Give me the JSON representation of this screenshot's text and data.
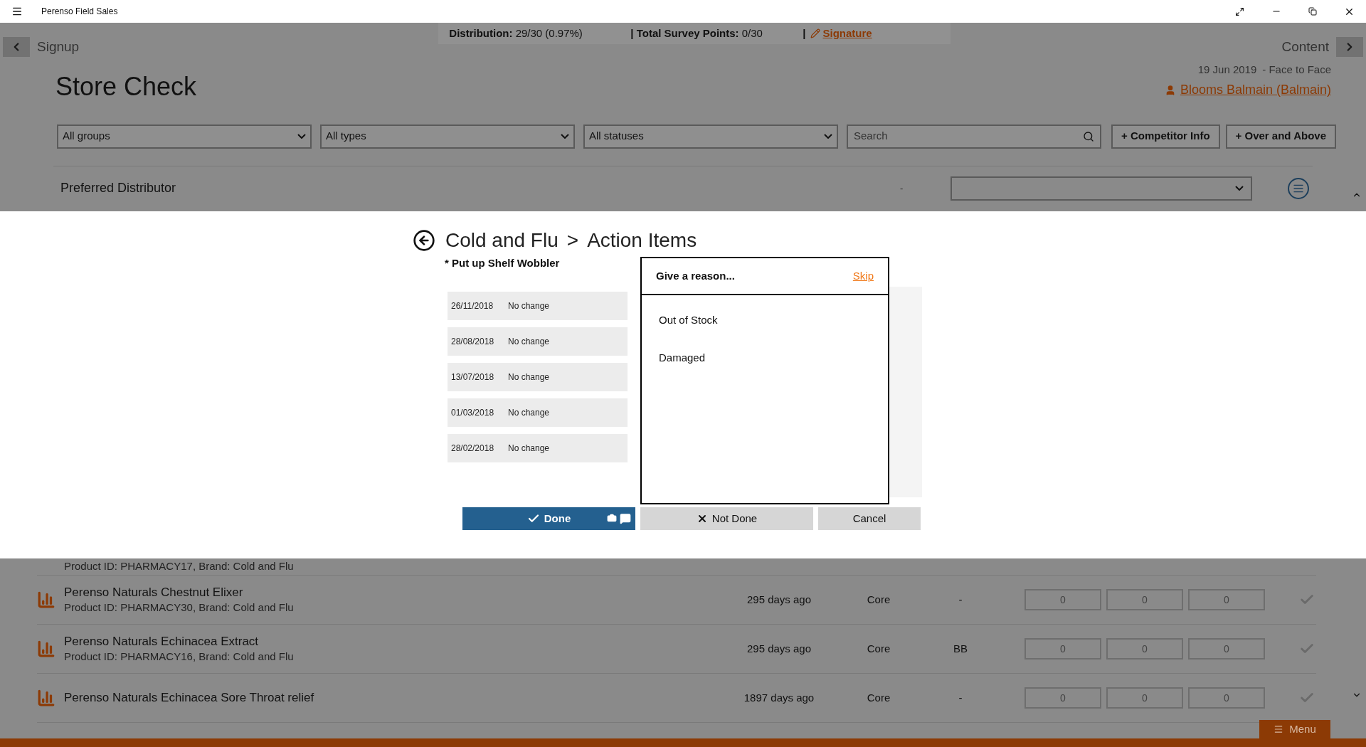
{
  "window": {
    "title": "Perenso Field Sales"
  },
  "status_strip": {
    "items": [
      "**Distribution:** 29/30 (0.97%)",
      "**| Total Survey Points:** 0/30"
    ],
    "separator": "|",
    "signature_link": "Signature"
  },
  "nav": {
    "back": "Signup",
    "forward": "Content"
  },
  "page": {
    "title": "Store Check",
    "date": "19 Jun 2019",
    "visit_type": "- Face to Face",
    "customer": "Blooms Balmain (Balmain)"
  },
  "filters": [
    {
      "kind": "dropdown",
      "value": "All groups"
    },
    {
      "kind": "dropdown",
      "value": "All types"
    },
    {
      "kind": "dropdown",
      "value": "All statuses"
    },
    {
      "kind": "search",
      "placeholder": "Search"
    }
  ],
  "actions": [
    "+ Competitor Info",
    "+ Over and Above"
  ],
  "preferred_distributor": {
    "label": "Preferred Distributor",
    "value": "-"
  },
  "dialog": {
    "breadcrumb": "Cold and Flu",
    "separator": ">",
    "title": "Action Items",
    "item": "* Put up Shelf Wobbler",
    "history": [
      {
        "date": "26/11/2018",
        "status": "No change"
      },
      {
        "date": "28/08/2018",
        "status": "No change"
      },
      {
        "date": "13/07/2018",
        "status": "No change"
      },
      {
        "date": "01/03/2018",
        "status": "No change"
      },
      {
        "date": "28/02/2018",
        "status": "No change"
      }
    ],
    "reason_popup": {
      "title": "Give a reason...",
      "skip": "Skip",
      "options": [
        "Out of Stock",
        "Damaged"
      ]
    },
    "buttons": [
      {
        "kind": "done",
        "label": "Done"
      },
      {
        "kind": "not_done",
        "label": "Not Done"
      },
      {
        "kind": "cancel",
        "label": "Cancel"
      }
    ]
  },
  "products": [
    {
      "detail": "Product ID: PHARMACY17, Brand: Cold and Flu"
    },
    {
      "name": "Perenso Naturals Chestnut Elixer",
      "detail": "Product ID: PHARMACY30, Brand: Cold and Flu",
      "age": "295 days ago",
      "range": "Core",
      "code": "-",
      "counts": [
        "0",
        "0",
        "0"
      ]
    },
    {
      "name": "Perenso Naturals Echinacea Extract",
      "detail": "Product ID: PHARMACY16, Brand: Cold and Flu",
      "age": "295 days ago",
      "range": "Core",
      "code": "BB",
      "counts": [
        "0",
        "0",
        "0"
      ]
    },
    {
      "name": "Perenso Naturals Echinacea Sore Throat relief",
      "age": "1897 days ago",
      "range": "Core",
      "code": "-",
      "counts": [
        "0",
        "0",
        "0"
      ]
    }
  ],
  "menu_button": "Menu"
}
